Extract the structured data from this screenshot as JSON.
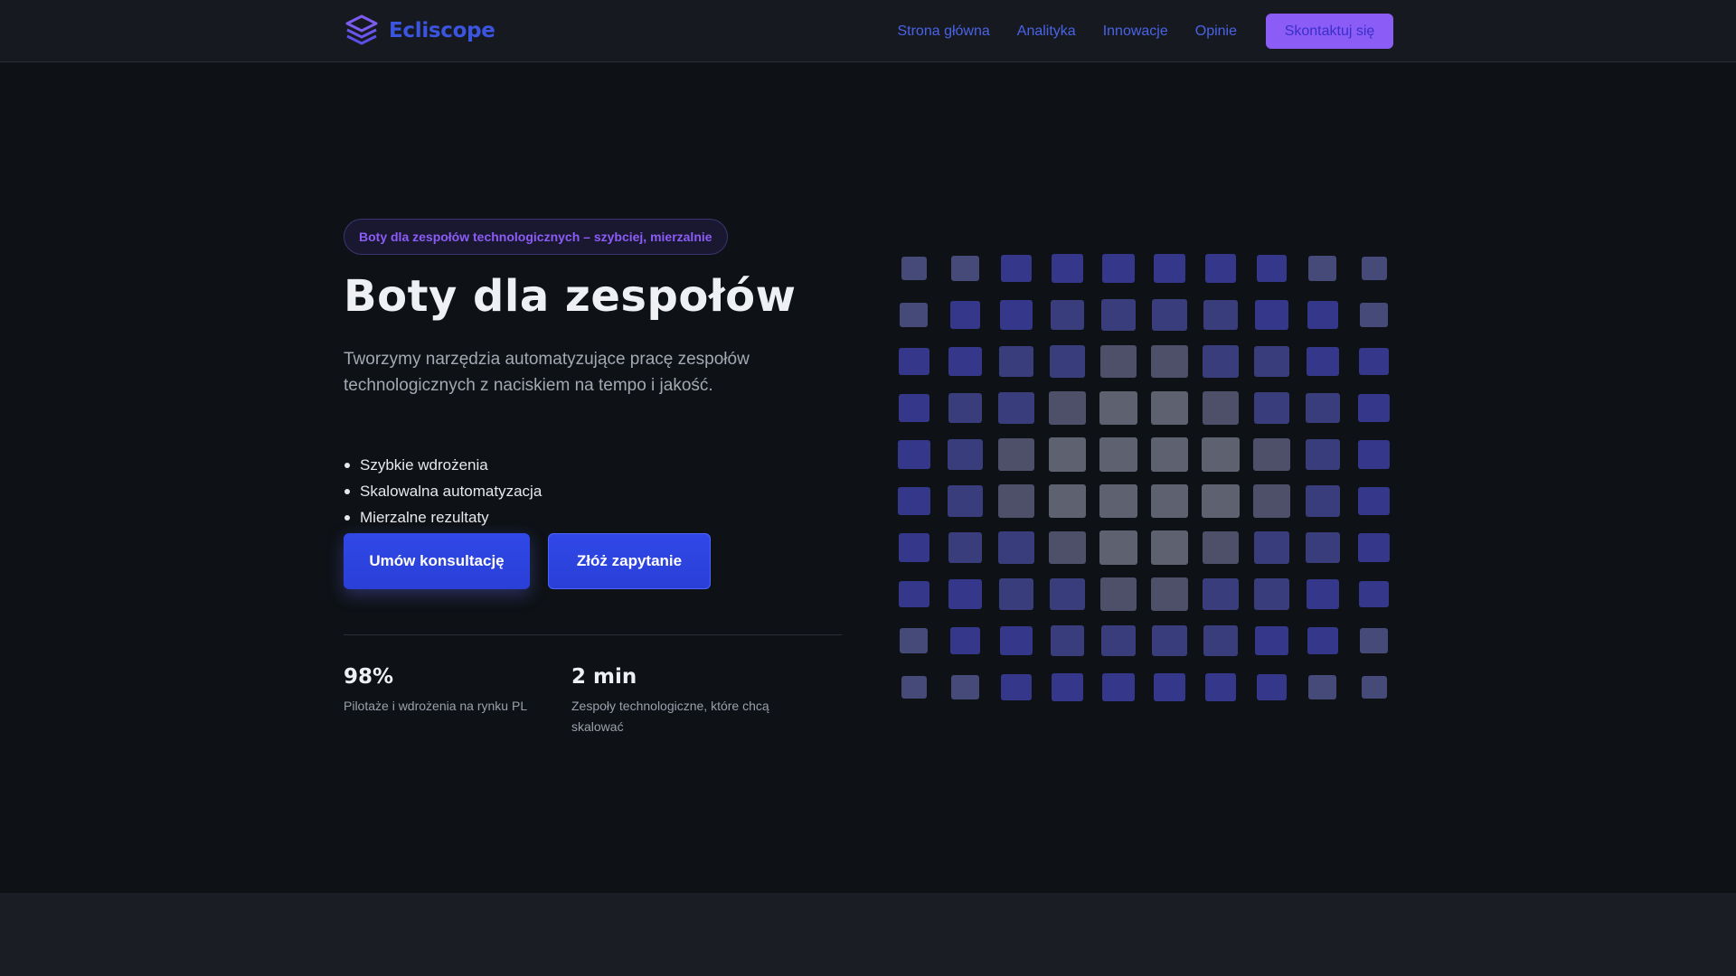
{
  "brand": {
    "name": "Ecliscope",
    "logo_icon": "layers-icon",
    "color": "#3b55e0"
  },
  "nav": {
    "items": [
      {
        "label": "Strona główna"
      },
      {
        "label": "Analityka"
      },
      {
        "label": "Innowacje"
      },
      {
        "label": "Opinie"
      }
    ],
    "cta_label": "Skontaktuj się"
  },
  "hero": {
    "badge": "Boty dla zespołów technologicznych – szybciej, mierzalnie",
    "title": "Boty dla zespołów",
    "subtitle": "Tworzymy narzędzia automatyzujące pracę zespołów technologicznych z naciskiem na tempo i jakość.",
    "features": [
      "Szybkie wdrożenia",
      "Skalowalna automatyzacja",
      "Mierzalne rezultaty"
    ],
    "primary_button": "Umów konsultację",
    "secondary_button": "Złóż zapytanie"
  },
  "stats": [
    {
      "value": "98%",
      "label": "Pilotaże i wdrożenia na rynku PL"
    },
    {
      "value": "2 min",
      "label": "Zespoły technologiczne, które chcą skalować"
    }
  ],
  "colors": {
    "accent": "#8b5cf6",
    "button": "#2f46e4",
    "background": "#0e1216",
    "header": "#161a20"
  }
}
